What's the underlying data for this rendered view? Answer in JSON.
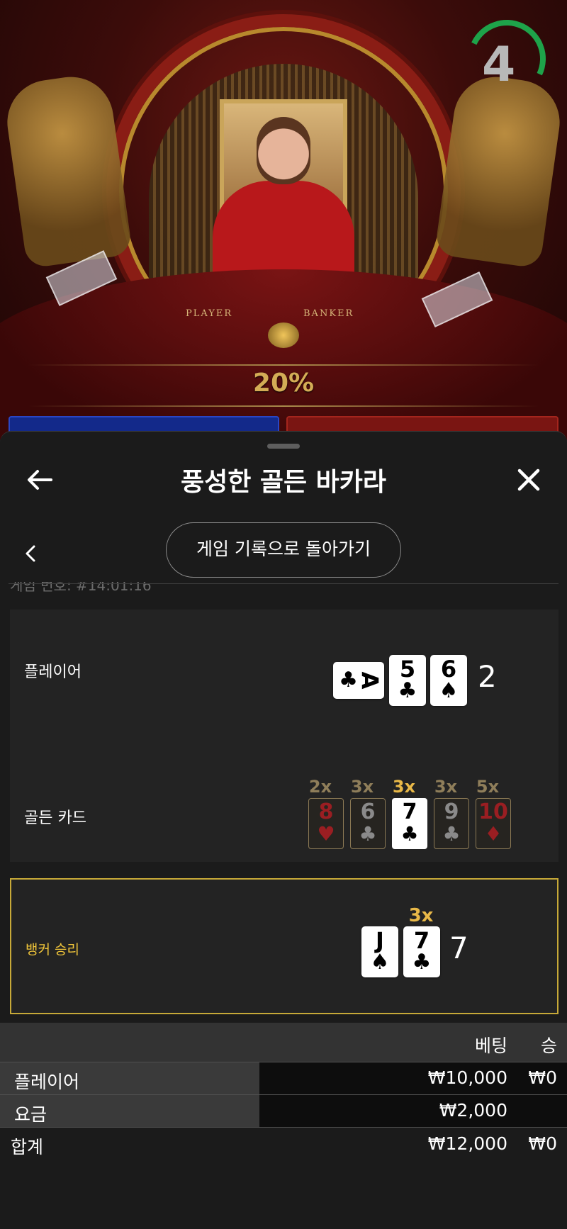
{
  "video": {
    "table_labels": [
      "PLAYER",
      "BANKER"
    ],
    "percent": "20%",
    "timer": "4"
  },
  "panel": {
    "title": "풍성한 골든 바카라",
    "history_button": "게임 기록으로 돌아가기",
    "game_id_partial": "게임 번호: #14:01:16"
  },
  "player": {
    "label": "플레이어",
    "cards": [
      {
        "rank": "A",
        "suit": "♣",
        "red": false,
        "sideways": true
      },
      {
        "rank": "5",
        "suit": "♣",
        "red": false
      },
      {
        "rank": "6",
        "suit": "♠",
        "red": false
      }
    ],
    "total": "2"
  },
  "golden": {
    "label": "골든 카드",
    "cards": [
      {
        "mult": "2x",
        "rank": "8",
        "suit": "♥",
        "red": true,
        "active": false
      },
      {
        "mult": "3x",
        "rank": "6",
        "suit": "♣",
        "red": false,
        "active": false
      },
      {
        "mult": "3x",
        "rank": "7",
        "suit": "♣",
        "red": false,
        "active": true
      },
      {
        "mult": "3x",
        "rank": "9",
        "suit": "♣",
        "red": false,
        "active": false
      },
      {
        "mult": "5x",
        "rank": "10",
        "suit": "♦",
        "red": true,
        "active": false
      }
    ]
  },
  "banker": {
    "label": "뱅커 승리",
    "multiplier": "3x",
    "cards": [
      {
        "rank": "J",
        "suit": "♠",
        "red": false
      },
      {
        "rank": "7",
        "suit": "♣",
        "red": false
      }
    ],
    "total": "7"
  },
  "bets": {
    "headers": {
      "bet": "베팅",
      "win": "승"
    },
    "rows": [
      {
        "label": "플레이어",
        "bet": "₩10,000",
        "win": "₩0"
      },
      {
        "label": "요금",
        "bet": "₩2,000",
        "win": ""
      }
    ],
    "total": {
      "label": "합계",
      "bet": "₩12,000",
      "win": "₩0"
    }
  },
  "colors": {
    "accent_gold": "#e9b948",
    "banker_border": "#c7a938",
    "timer_green": "#1ea34a"
  }
}
